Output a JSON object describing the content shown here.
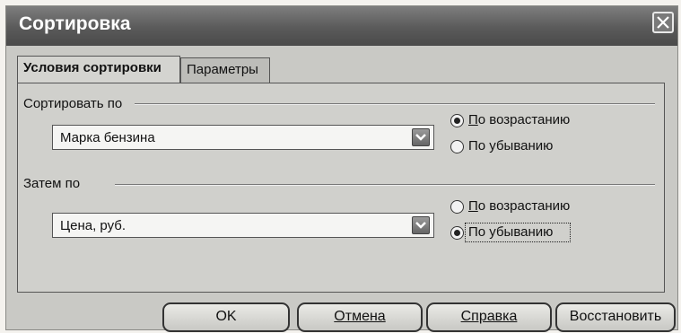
{
  "dialog": {
    "title": "Сортировка",
    "close_symbol": "×"
  },
  "tabs": [
    {
      "label": "Условия сортировки",
      "active": true
    },
    {
      "label": "Параметры",
      "active": false
    }
  ],
  "sort1": {
    "label": "Сортировать по",
    "selected": "Марка бензина",
    "asc_label": "По возрастанию",
    "desc_label": "По убыванию",
    "order": "asc"
  },
  "sort2": {
    "label": "Затем по",
    "selected": "Цена, руб.",
    "asc_label": "По возрастанию",
    "desc_label": "По убыванию",
    "order": "desc"
  },
  "buttons": {
    "ok": "OK",
    "cancel": "Отмена",
    "help": "Справка",
    "reset": "Восстановить"
  },
  "icons": {
    "close": "close-icon",
    "dropdown": "chevron-down-icon"
  }
}
